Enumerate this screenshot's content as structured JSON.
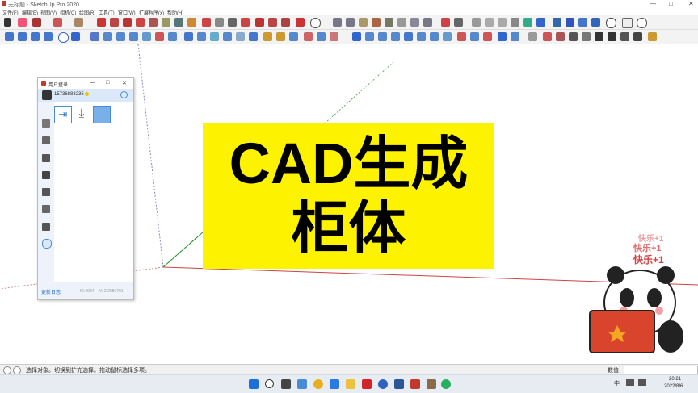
{
  "window": {
    "title": "无标题 - SketchUp Pro 2020",
    "min": "—",
    "max": "□",
    "close": "✕"
  },
  "menu": [
    "文件(F)",
    "编辑(E)",
    "视图(V)",
    "相机(C)",
    "绘图(R)",
    "工具(T)",
    "窗口(W)",
    "扩展程序(x)",
    "帮助(H)"
  ],
  "banner": {
    "line1": "CAD生成",
    "line2": "柜体"
  },
  "panel": {
    "title": "用户登录",
    "username": "15736883235",
    "footer_link": "更新日志",
    "footer_id": "ID:4084",
    "footer_version": "V: 2.2080701",
    "search_icon": "search-icon",
    "actions": [
      "logout-icon",
      "download-icon",
      "save-file-icon"
    ]
  },
  "statusbar": {
    "hint": "选择对象。切换到扩充选择。拖动鼠标选择多项。",
    "measure_label": "数值"
  },
  "taskbar": {
    "ime": "中",
    "time": "20:21",
    "date": "2022/8/6"
  },
  "sticker": {
    "text": "快乐+1"
  },
  "colors": {
    "banner": "#fdf200",
    "red_axis": "#c44",
    "green_axis": "#3a3",
    "blue_axis": "#44c"
  }
}
